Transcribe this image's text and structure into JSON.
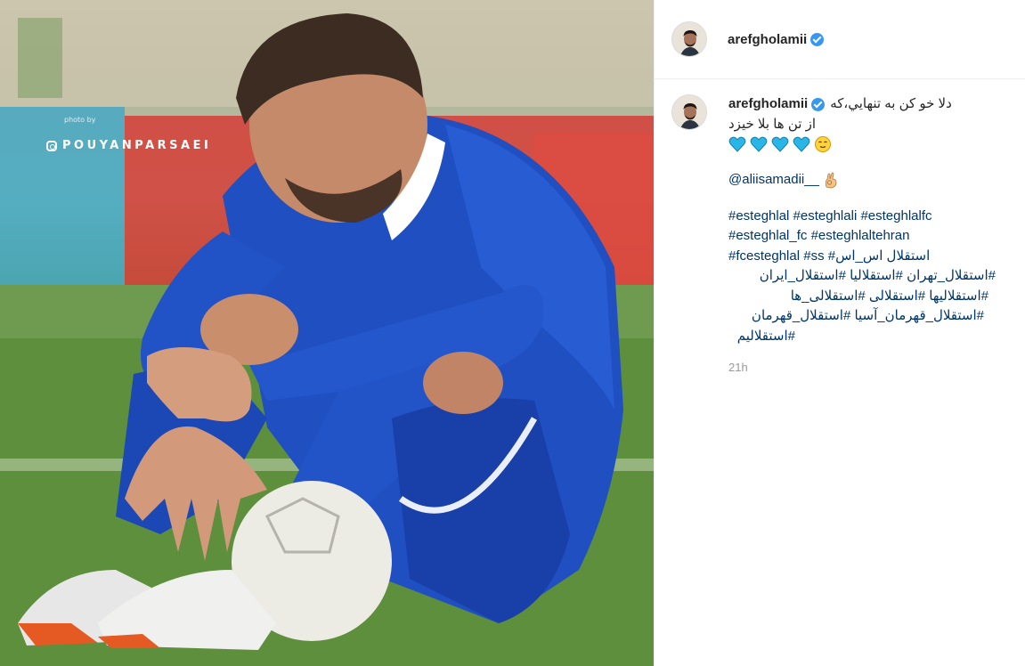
{
  "post": {
    "username": "arefgholamii",
    "verified": true,
    "photo": {
      "watermark_small": "photo by",
      "watermark": "POUYANPARSAEI"
    }
  },
  "caption": {
    "username": "arefgholamii",
    "line1": "دلا خو كن به تنهايي،كه",
    "line2": "از تن ها بلا خيزد",
    "mention": "@aliisamadii__",
    "hashtags": [
      "#esteghlal #esteghlali #esteghlalfc",
      "#esteghlal_fc #esteghlaltehran",
      "#fcesteghlal #ss #استقلال اس_اس",
      "#استقلال_تهران #استقلاليا #استقلال_ايران",
      "#استقلاليها #استقلالی #استقلالی_ها",
      "#استقلال_قهرمان_آسیا #استقلال_قهرمان",
      "#استقلاليم"
    ],
    "timestamp": "21h"
  },
  "colors": {
    "link": "#003569",
    "verified": "#3897f0",
    "heart": "#29b6e6",
    "muted": "#999999"
  },
  "icons": [
    "verified-badge-icon",
    "blue-heart-icon",
    "relieved-face-icon",
    "ok-hand-icon"
  ]
}
